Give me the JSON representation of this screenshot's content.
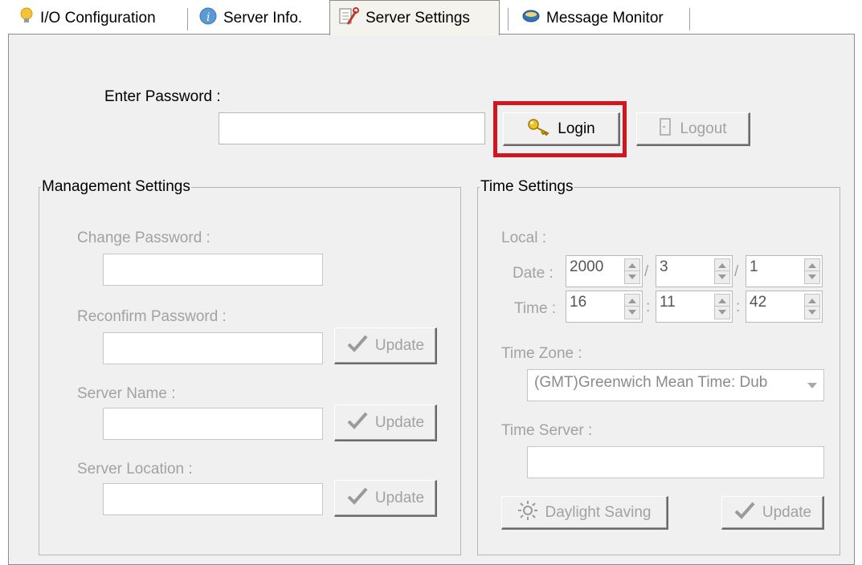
{
  "tabs": [
    {
      "label": "I/O Configuration",
      "icon": "lightbulb-icon"
    },
    {
      "label": "Server Info.",
      "icon": "info-icon"
    },
    {
      "label": "Server Settings",
      "icon": "settings-wrench-icon",
      "active": true
    },
    {
      "label": "Message Monitor",
      "icon": "monitor-icon"
    }
  ],
  "login": {
    "password_label": "Enter Password :",
    "password_value": "",
    "login_label": "Login",
    "logout_label": "Logout"
  },
  "management": {
    "title": "Management Settings",
    "change_password_label": "Change Password :",
    "reconfirm_password_label": "Reconfirm Password :",
    "server_name_label": "Server Name :",
    "server_location_label": "Server Location :",
    "update_label": "Update"
  },
  "time": {
    "title": "Time Settings",
    "local_label": "Local :",
    "date_label": "Date :",
    "time_label": "Time :",
    "date_year": "2000",
    "date_month": "3",
    "date_day": "1",
    "date_sep": "/",
    "time_hour": "16",
    "time_minute": "11",
    "time_second": "42",
    "time_sep": ":",
    "time_zone_label": "Time Zone :",
    "time_zone_value": "(GMT)Greenwich Mean Time: Dub",
    "time_server_label": "Time Server :",
    "time_server_value": "",
    "daylight_label": "Daylight Saving",
    "update_label": "Update"
  },
  "colors": {
    "highlight": "#d0171f",
    "disabled_text": "#a2a2a2"
  }
}
